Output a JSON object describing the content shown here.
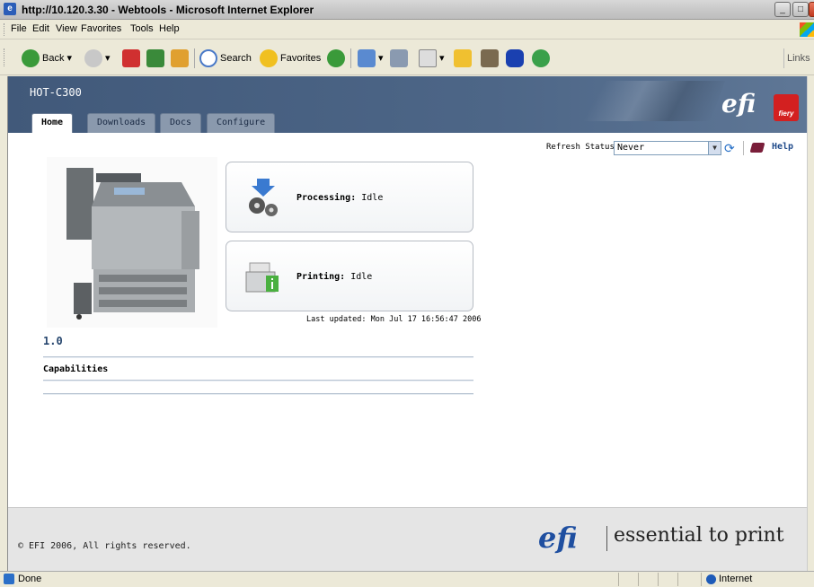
{
  "window": {
    "title": "http://10.120.3.30 - Webtools - Microsoft Internet Explorer",
    "controls": [
      "_",
      "□",
      "X"
    ]
  },
  "menu": [
    "File",
    "Edit",
    "View",
    "Favorites",
    "Tools",
    "Help"
  ],
  "toolbar": {
    "back_label": "Back",
    "search_label": "Search",
    "favorites_label": "Favorites",
    "links_label": "Links"
  },
  "header": {
    "device_name": "HOT-C300",
    "logo_text": "efi",
    "fiery_text": "fiery",
    "tabs": [
      {
        "label": "Home",
        "active": true
      },
      {
        "label": "Downloads",
        "active": false
      },
      {
        "label": "Docs",
        "active": false
      },
      {
        "label": "Configure",
        "active": false
      }
    ]
  },
  "refresh": {
    "label": "Refresh Status:",
    "selected": "Never"
  },
  "help_label": "Help",
  "device": {
    "version": "1.0"
  },
  "status": {
    "processing_label": "Processing:",
    "processing_value": "Idle",
    "printing_label": "Printing:",
    "printing_value": "Idle",
    "last_updated": "Last updated: Mon Jul 17 16:56:47 2006"
  },
  "capabilities_label": "Capabilities",
  "footer": {
    "copyright": "© EFI 2006, All rights reserved.",
    "logo_text": "efi",
    "tagline": "essential to print"
  },
  "statusbar": {
    "text": "Done",
    "zone": "Internet"
  },
  "colors": {
    "header_bg": "#4d6687",
    "link": "#1f4a8a",
    "efi_blue": "#1f4fa0"
  }
}
